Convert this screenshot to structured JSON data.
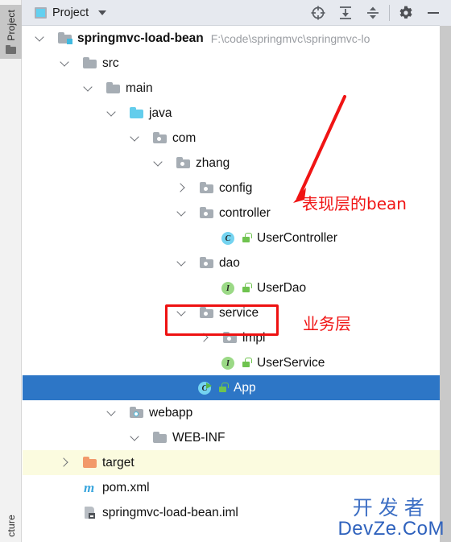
{
  "rail": {
    "top_tool": {
      "label": "Project",
      "icon": "folder-icon",
      "active": true
    },
    "bottom_tool": {
      "label": "cture",
      "icon": "structure-icon"
    }
  },
  "header": {
    "title": "Project",
    "dropdown_icon": "chevron-down-icon",
    "panel_icon": "project-panel-icon",
    "tools": [
      {
        "name": "locate-icon",
        "tooltip": "Select Opened File"
      },
      {
        "name": "expand-all-icon",
        "tooltip": "Expand All"
      },
      {
        "name": "collapse-all-icon",
        "tooltip": "Collapse All"
      },
      {
        "name": "settings-gear-icon",
        "tooltip": "Settings"
      },
      {
        "name": "minimize-icon",
        "tooltip": "Hide"
      }
    ]
  },
  "tree": [
    {
      "label": "springmvc-load-bean",
      "path": "F:\\code\\springmvc\\springmvc-lo",
      "icon": "module-folder-icon",
      "arrow": "down",
      "depth": 0,
      "bold": true
    },
    {
      "label": "src",
      "icon": "folder-icon",
      "arrow": "down",
      "depth": 1
    },
    {
      "label": "main",
      "icon": "folder-icon",
      "arrow": "down",
      "depth": 2
    },
    {
      "label": "java",
      "icon": "source-folder-icon",
      "arrow": "down",
      "depth": 3
    },
    {
      "label": "com",
      "icon": "package-icon",
      "arrow": "down",
      "depth": 4
    },
    {
      "label": "zhang",
      "icon": "package-icon",
      "arrow": "down",
      "depth": 5
    },
    {
      "label": "config",
      "icon": "package-icon",
      "arrow": "right",
      "depth": 6
    },
    {
      "label": "controller",
      "icon": "package-icon",
      "arrow": "down",
      "depth": 6
    },
    {
      "label": "UserController",
      "icon": "class-icon",
      "arrow": "none",
      "depth": 7,
      "lock": true
    },
    {
      "label": "dao",
      "icon": "package-icon",
      "arrow": "down",
      "depth": 6
    },
    {
      "label": "UserDao",
      "icon": "interface-icon",
      "arrow": "none",
      "depth": 7,
      "lock": true
    },
    {
      "label": "service",
      "icon": "package-icon",
      "arrow": "down",
      "depth": 6
    },
    {
      "label": "impl",
      "icon": "package-icon",
      "arrow": "right",
      "depth": 7
    },
    {
      "label": "UserService",
      "icon": "interface-icon",
      "arrow": "none",
      "depth": 7,
      "lock": true
    },
    {
      "label": "App",
      "icon": "runnable-class-icon",
      "arrow": "none",
      "depth": 6,
      "lock": true,
      "selected": true
    },
    {
      "label": "webapp",
      "icon": "webapp-folder-icon",
      "arrow": "down",
      "depth": 3
    },
    {
      "label": "WEB-INF",
      "icon": "folder-icon",
      "arrow": "down",
      "depth": 4
    },
    {
      "label": "target",
      "icon": "target-folder-icon",
      "arrow": "right",
      "depth": 1,
      "marked": true
    },
    {
      "label": "pom.xml",
      "icon": "maven-icon",
      "arrow": "none",
      "depth": 1
    },
    {
      "label": "springmvc-load-bean.iml",
      "icon": "iml-file-icon",
      "arrow": "none",
      "depth": 1
    }
  ],
  "annotations": {
    "arrow_note": "表现层的bean",
    "box_note": "业务层",
    "color": "#f01414"
  },
  "watermark": {
    "cn": "开发者",
    "en": "DevZe.CoM",
    "color": "#3d6fc4"
  }
}
